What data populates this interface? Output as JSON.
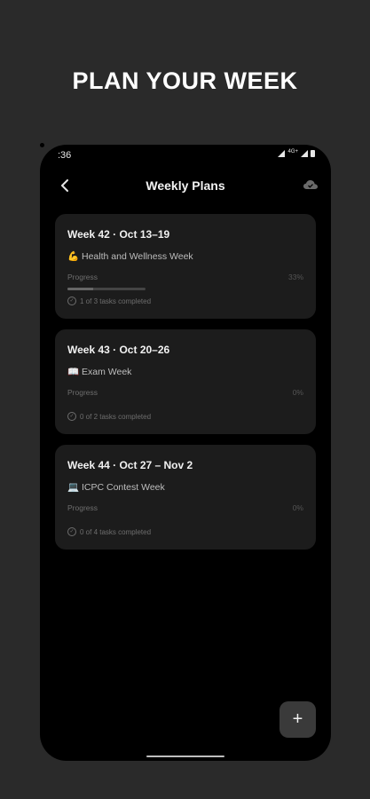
{
  "headline": "PLAN YOUR WEEK",
  "status_bar": {
    "time": ":36",
    "network": "4G+"
  },
  "app_bar": {
    "title": "Weekly Plans",
    "back_icon": "chevron-left-icon",
    "cloud_icon": "cloud-icon"
  },
  "progress_label": "Progress",
  "plans": [
    {
      "title": "Week 42 · Oct 13–19",
      "emoji": "💪",
      "name": "Health and Wellness Week",
      "percent_text": "33%",
      "progress": 0.33,
      "tasks_text": "1 of 3 tasks completed"
    },
    {
      "title": "Week 43 · Oct 20–26",
      "emoji": "📖",
      "name": "Exam Week",
      "percent_text": "0%",
      "progress": 0,
      "tasks_text": "0 of 2 tasks completed"
    },
    {
      "title": "Week 44 · Oct 27 – Nov 2",
      "emoji": "💻",
      "name": "ICPC Contest Week",
      "percent_text": "0%",
      "progress": 0,
      "tasks_text": "0 of 4 tasks completed"
    }
  ],
  "fab": {
    "label": "+",
    "icon": "plus-icon"
  },
  "colors": {
    "background": "#2a2a2a",
    "phone": "#000000",
    "card": "#1c1c1c",
    "fab": "#3a3a3a"
  }
}
